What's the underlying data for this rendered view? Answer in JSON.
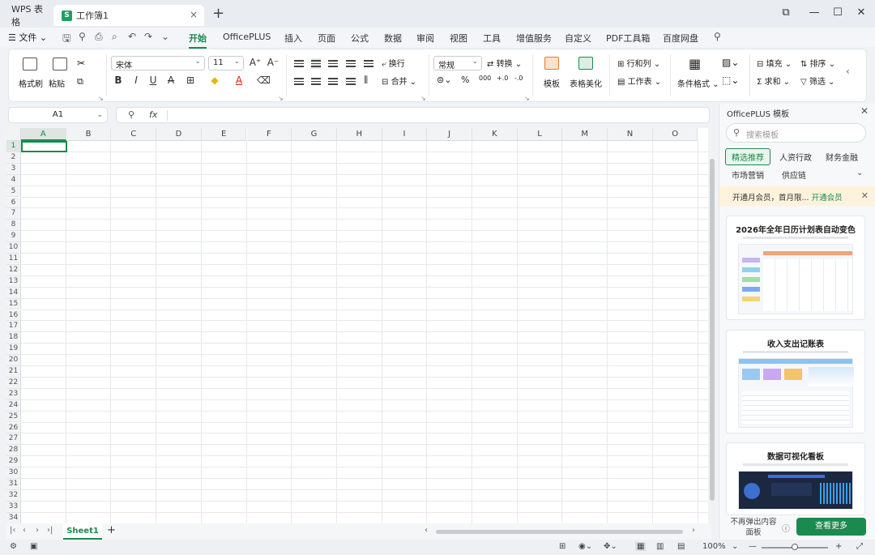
{
  "titlebar": {
    "home_tab": "WPS 表格",
    "doc_badge": "S",
    "doc_tab": "工作簿1",
    "close_glyph": "×",
    "new_tab_glyph": "+",
    "controls": [
      "⧉",
      "—",
      "☐",
      "✕"
    ]
  },
  "menubar": {
    "file_label": "文件",
    "tabs": [
      "开始",
      "OfficePLUS",
      "插入",
      "页面",
      "公式",
      "数据",
      "审阅",
      "视图",
      "工具",
      "增值服务",
      "自定义",
      "PDF工具箱",
      "百度网盘"
    ],
    "active_tab": "开始"
  },
  "ribbon": {
    "format_painter": "格式刷",
    "paste": "粘贴",
    "font_name": "宋体",
    "font_size": "11",
    "wrap": "换行",
    "merge": "合并",
    "number_format": "常规",
    "convert": "转换",
    "template": "模板",
    "table_beautify": "表格美化",
    "rows_cols": "行和列",
    "worksheet": "工作表",
    "conditional_format": "条件格式",
    "fill": "填充",
    "sort": "排序",
    "sum": "求和",
    "filter": "筛选",
    "bold": "B",
    "italic": "I",
    "underline": "U",
    "strike": "A",
    "percent": "%",
    "thousands": "000",
    "inc_dec": "+.0",
    "dec_dec": "-.0",
    "grow_font": "A⁺",
    "shrink_font": "A⁻"
  },
  "formula_bar": {
    "name_box": "A1",
    "fx": "fx",
    "formula": ""
  },
  "grid": {
    "columns": [
      "A",
      "B",
      "C",
      "D",
      "E",
      "F",
      "G",
      "H",
      "I",
      "J",
      "K",
      "L",
      "M",
      "N",
      "O"
    ],
    "rows": [
      "1",
      "2",
      "3",
      "4",
      "5",
      "6",
      "7",
      "8",
      "9",
      "10",
      "11",
      "12",
      "13",
      "14",
      "15",
      "16",
      "17",
      "18",
      "19",
      "20",
      "21",
      "22",
      "23",
      "24",
      "25",
      "26",
      "27",
      "28",
      "29",
      "30",
      "31",
      "32",
      "33",
      "34"
    ],
    "selected_cell": "A1"
  },
  "sheets": {
    "tabs": [
      "Sheet1"
    ],
    "add": "+"
  },
  "status": {
    "zoom": "100%"
  },
  "panel": {
    "title": "OfficePLUS 模板",
    "search_placeholder": "搜索模板",
    "categories": [
      "精选推荐",
      "人资行政",
      "财务金融",
      "市场营销",
      "供应链"
    ],
    "active_category": "精选推荐",
    "promo_text": "开通月会员，首月限...",
    "promo_link": "开通会员",
    "templates": [
      "2026年全年日历计划表自动变色",
      "收入支出记账表",
      "数据可视化看板"
    ],
    "footer_text": "不再弹出内容面板",
    "more_button": "查看更多"
  },
  "colors": {
    "accent": "#1a8a4f",
    "doc_badge": "#1aa260"
  }
}
